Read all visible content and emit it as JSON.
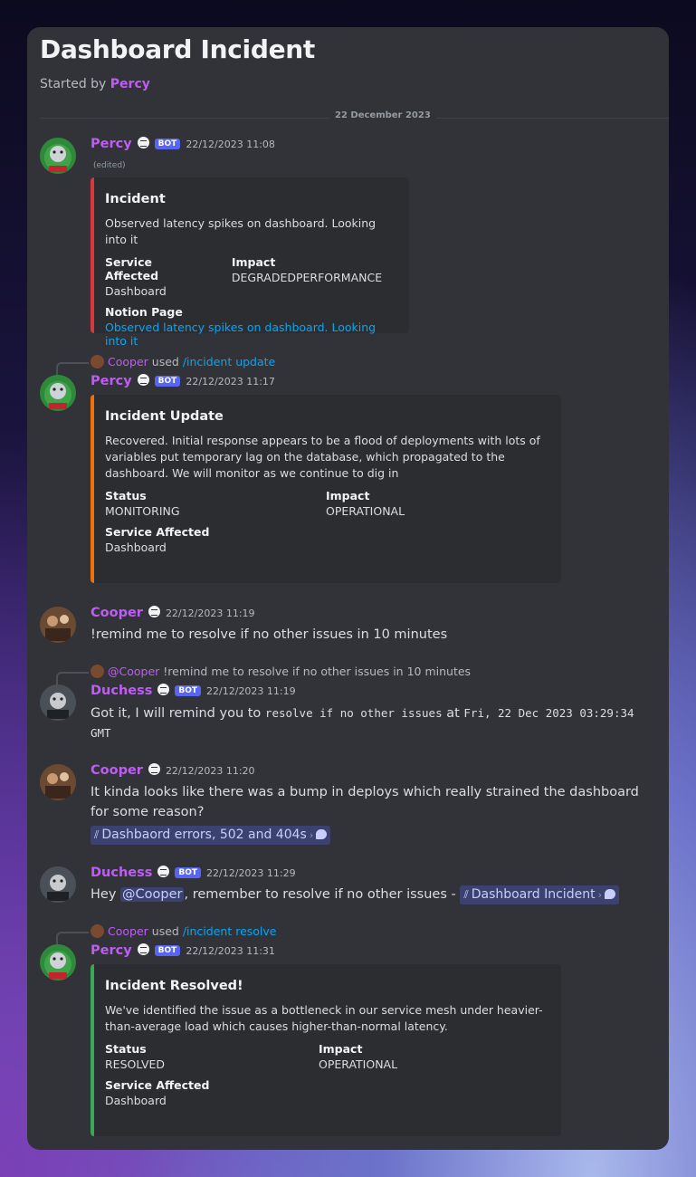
{
  "thread": {
    "title": "Dashboard Incident",
    "started_prefix": "Started by",
    "started_by": "Percy"
  },
  "divider": {
    "date": "22 December 2023"
  },
  "messages": [
    {
      "author": "Percy",
      "bot": "BOT",
      "timestamp": "22/12/2023 11:08",
      "edited": "(edited)",
      "embed": {
        "color": "#da373c",
        "title": "Incident",
        "description": "Observed latency spikes on dashboard. Looking into it",
        "fields": [
          {
            "name": "Service Affected",
            "value": "Dashboard"
          },
          {
            "name": "Impact",
            "value": "DEGRADEDPERFORMANCE"
          },
          {
            "name": "Notion Page",
            "value": "Observed latency spikes on dashboard. Looking into it"
          }
        ]
      }
    },
    {
      "reply": {
        "name": "Cooper",
        "used": "used",
        "command": "/incident update"
      },
      "author": "Percy",
      "bot": "BOT",
      "timestamp": "22/12/2023 11:17",
      "embed": {
        "color": "#f0700c",
        "title": "Incident Update",
        "description": "Recovered. Initial response appears to be a flood of deployments with lots of variables put temporary lag on the database, which propagated to the dashboard. We will monitor as we continue to dig in",
        "fields": [
          {
            "name": "Status",
            "value": "MONITORING"
          },
          {
            "name": "Impact",
            "value": "OPERATIONAL"
          },
          {
            "name": "Service Affected",
            "value": "Dashboard"
          }
        ]
      }
    },
    {
      "author": "Cooper",
      "timestamp": "22/12/2023 11:19",
      "text": "!remind me to resolve if no other issues in 10 minutes"
    },
    {
      "reply": {
        "name": "@Cooper",
        "text": "!remind me to resolve if no other issues in 10 minutes"
      },
      "author": "Duchess",
      "bot": "BOT",
      "timestamp": "22/12/2023 11:19",
      "text_a": "Got it, I will remind you to",
      "code_a": "resolve if no other issues",
      "text_b": "at",
      "code_b": "Fri, 22 Dec 2023 03:29:34 GMT"
    },
    {
      "author": "Cooper",
      "timestamp": "22/12/2023 11:20",
      "text": "It kinda looks like there was a bump in deploys which really strained the dashboard for some reason?",
      "channel": "Dashbaord errors, 502 and 404s"
    },
    {
      "author": "Duchess",
      "bot": "BOT",
      "timestamp": "22/12/2023 11:29",
      "text_a": "Hey",
      "mention": "@Cooper",
      "text_b": ", remember to resolve if no other issues -",
      "channel": "Dashboard Incident"
    },
    {
      "reply": {
        "name": "Cooper",
        "used": "used",
        "command": "/incident resolve"
      },
      "author": "Percy",
      "bot": "BOT",
      "timestamp": "22/12/2023 11:31",
      "embed": {
        "color": "#3ba55c",
        "title": "Incident Resolved!",
        "description": "We've identified the issue as a bottleneck in our service mesh under heavier-than-average load which causes higher-than-normal latency.",
        "fields": [
          {
            "name": "Status",
            "value": "RESOLVED"
          },
          {
            "name": "Impact",
            "value": "OPERATIONAL"
          },
          {
            "name": "Service Affected",
            "value": "Dashboard"
          }
        ]
      }
    }
  ]
}
